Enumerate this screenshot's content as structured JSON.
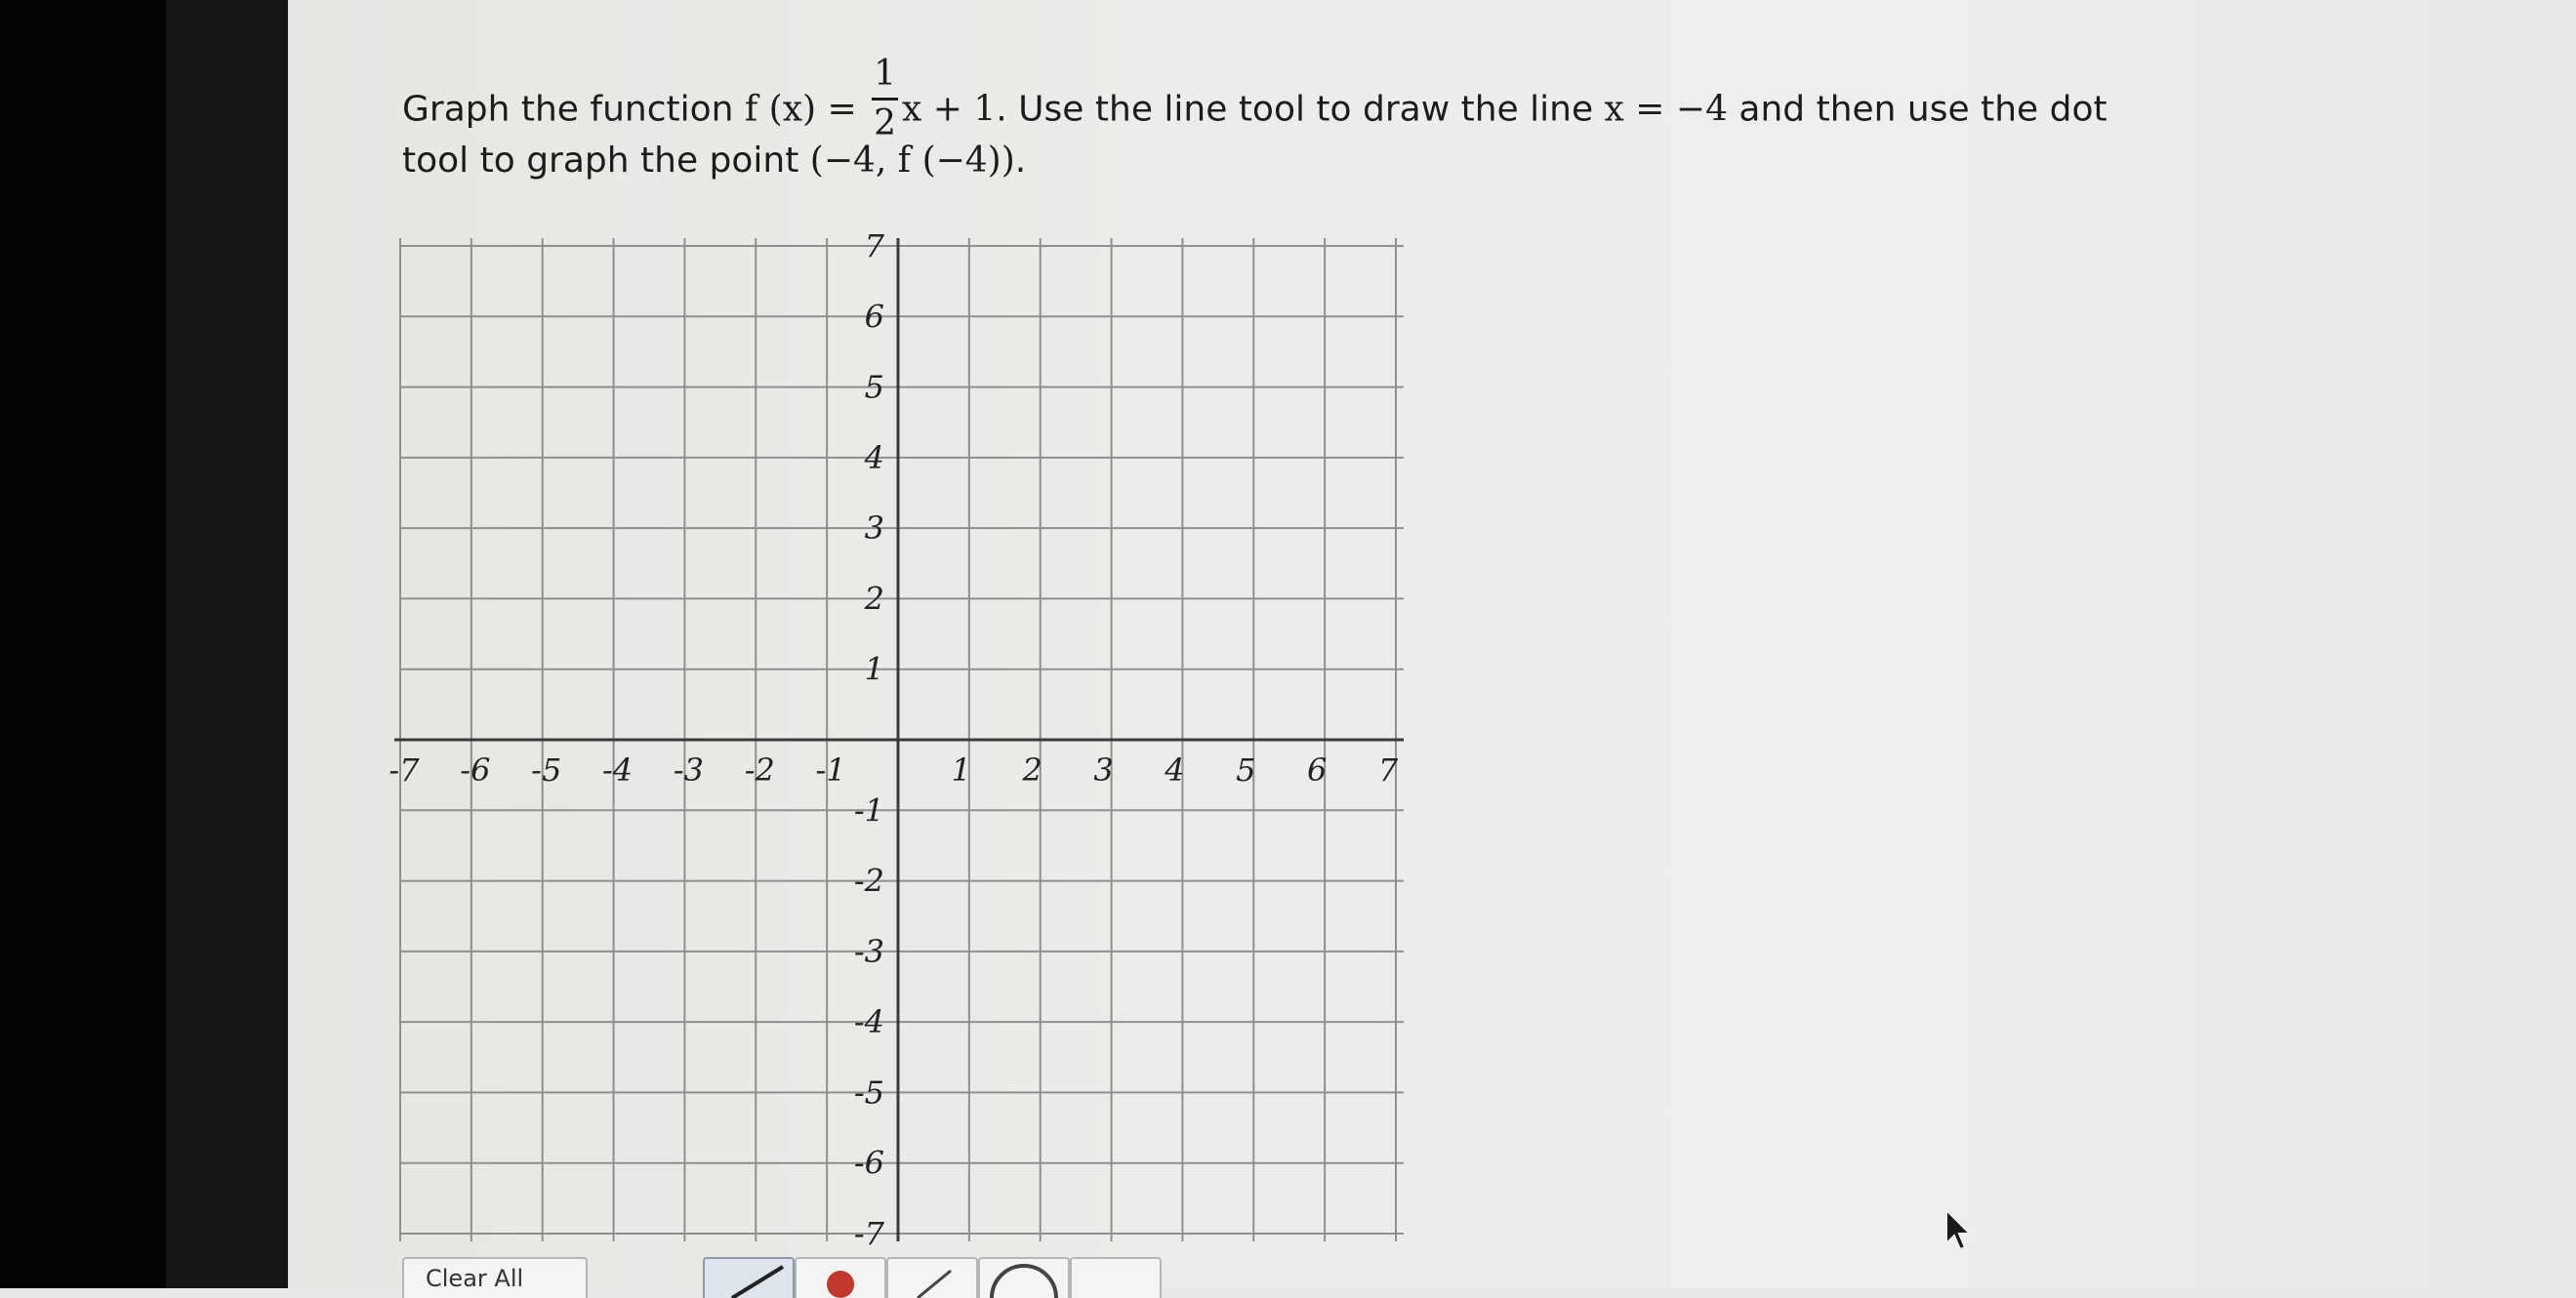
{
  "question": {
    "line1": {
      "intro": "Graph the function ",
      "func_lhs": "f (x) = ",
      "frac_num": "1",
      "frac_den": "2",
      "func_rhs": "x + 1",
      "after_func": ". Use the line tool to draw the line ",
      "line_eq": "x = −4",
      "outro": " and then use the dot"
    },
    "line2": {
      "intro": "tool to graph the point ",
      "point": "(−4, f (−4))",
      "end": "."
    }
  },
  "graph": {
    "x_range": [
      -7,
      7
    ],
    "y_range": [
      -7,
      7
    ],
    "x_tick_labels": [
      "-7",
      "-6",
      "-5",
      "-4",
      "-3",
      "-2",
      "-1",
      "1",
      "2",
      "3",
      "4",
      "5",
      "6",
      "7"
    ],
    "y_tick_labels": [
      "7",
      "6",
      "5",
      "4",
      "3",
      "2",
      "1",
      "-1",
      "-2",
      "-3",
      "-4",
      "-5",
      "-6",
      "-7"
    ],
    "grid": true,
    "grid_color": "#8f8f8f",
    "axis_color": "#3a3a3a",
    "label_color": "#222222"
  },
  "toolbar": {
    "clear_label": "Clear All",
    "selected_tool": "line",
    "tools": [
      "line-tool-icon",
      "dot-tool-icon",
      "segment-tool-icon",
      "circle-tool-icon",
      "more-tool-icon"
    ],
    "accent": "#c0392b"
  }
}
